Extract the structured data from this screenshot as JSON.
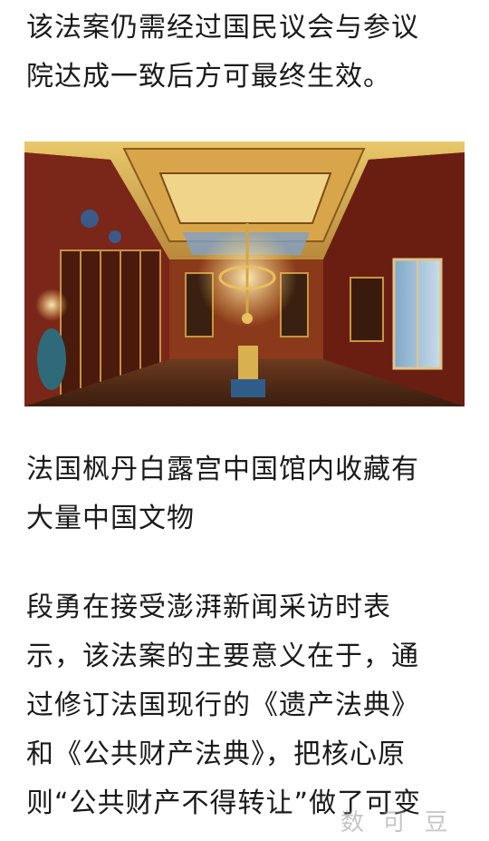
{
  "article": {
    "paragraph_1": {
      "lines": [
        "该法案仍需经过国民议会与参议",
        "院达成一致后方可最终生效。"
      ]
    },
    "photo": {
      "subject": "palace-interior-photo"
    },
    "caption": {
      "lines": [
        "法国枫丹白露宫中国馆内收藏有",
        "大量中国文物"
      ]
    },
    "paragraph_2": {
      "lines": [
        "段勇在接受澎湃新闻采访时表",
        "示，该法案的主要意义在于，通",
        "过修订法国现行的《遗产法典》",
        "和《公共财产法典》，把核心原",
        "则“公共财产不得转让”做了可变"
      ]
    },
    "watermark": "数 可 豆"
  },
  "colors": {
    "text": "#1a1a1a",
    "background": "#ffffff"
  }
}
